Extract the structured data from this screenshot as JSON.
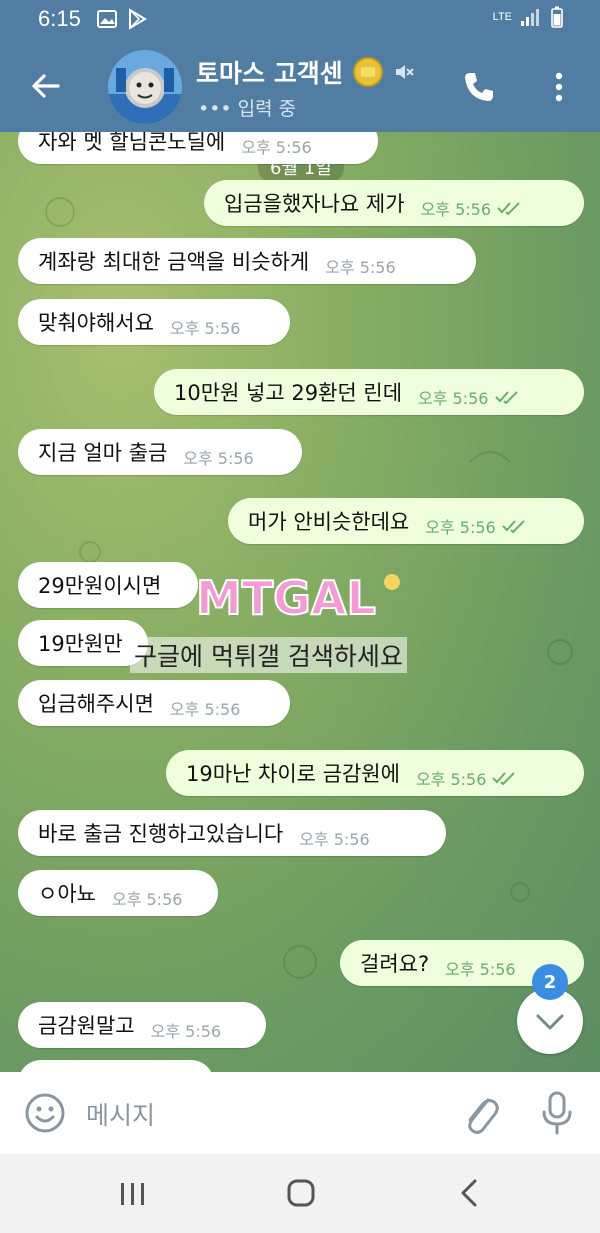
{
  "status_bar": {
    "time": "6:15",
    "network": "LTE"
  },
  "header": {
    "title": "토마스 고객센",
    "subtitle": "••• 입력 중",
    "icons": [
      "back-arrow-icon",
      "coin-icon",
      "mute-icon",
      "phone-icon",
      "more-vert-icon"
    ]
  },
  "chat": {
    "date_chip": "6월 1일",
    "messages": [
      {
        "dir": "in",
        "text": "자와 멧 할님콘노딜에",
        "time": "오후 5:56"
      },
      {
        "dir": "out",
        "text": "입금을했자나요 제가",
        "time": "오후 5:56"
      },
      {
        "dir": "in",
        "text": "계좌랑 최대한 금액을 비슷하게",
        "time": "오후 5:56"
      },
      {
        "dir": "in",
        "text": "맞춰야해서요",
        "time": "오후 5:56"
      },
      {
        "dir": "out",
        "text": "10만원 넣고 29환던 린데",
        "time": "오후 5:56"
      },
      {
        "dir": "in",
        "text": "지금 얼마 출금",
        "time": "오후 5:56"
      },
      {
        "dir": "out",
        "text": "머가 안비슷한데요",
        "time": "오후 5:56"
      },
      {
        "dir": "in",
        "text": "29만원이시면",
        "time": ""
      },
      {
        "dir": "in",
        "text": "19만원만",
        "time": ""
      },
      {
        "dir": "in",
        "text": "입금해주시면",
        "time": "오후 5:56"
      },
      {
        "dir": "out",
        "text": "19마난 차이로 금감원에",
        "time": "오후 5:56"
      },
      {
        "dir": "in",
        "text": "바로 출금 진행하고있습니다",
        "time": "오후 5:56"
      },
      {
        "dir": "in",
        "text": "ㅇ아뇨",
        "time": "오후 5:56"
      },
      {
        "dir": "out",
        "text": "걸려요?",
        "time": "오후 5:56"
      },
      {
        "dir": "in",
        "text": "금감원말고",
        "time": "오후 5:56"
      }
    ],
    "watermark_logo": "MTGAL",
    "watermark_text": "구글에 먹튀갤 검색하세요",
    "unread_badge": "2"
  },
  "input": {
    "placeholder": "메시지"
  },
  "colors": {
    "header": "#517da2",
    "bubble_in": "#ffffff",
    "bubble_out": "#effedd",
    "badge": "#3a8de0"
  }
}
